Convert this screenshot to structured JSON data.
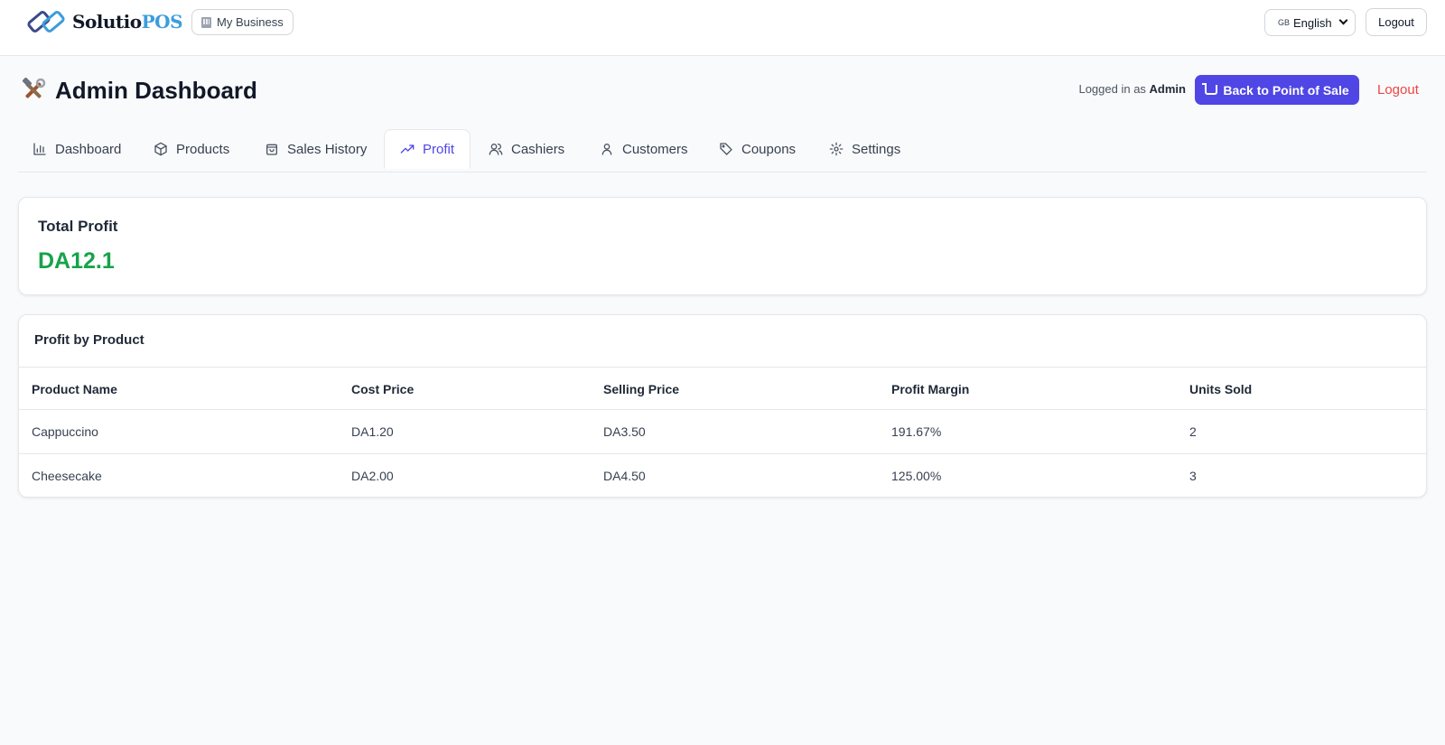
{
  "topbar": {
    "logo_part1": "Solutio",
    "logo_part2": "POS",
    "business_label": "My Business",
    "language": {
      "flag": "GB",
      "selected": "English"
    },
    "logout_label": "Logout"
  },
  "header": {
    "title": "Admin Dashboard",
    "logged_prefix": "Logged in as",
    "logged_user": "Admin",
    "back_pos_label": "Back to Point of Sale",
    "logout_label": "Logout"
  },
  "tabs": [
    {
      "label": "Dashboard",
      "icon": "bar-chart-icon"
    },
    {
      "label": "Products",
      "icon": "package-icon"
    },
    {
      "label": "Sales History",
      "icon": "shopping-bag-icon"
    },
    {
      "label": "Profit",
      "icon": "trending-up-icon",
      "active": true
    },
    {
      "label": "Cashiers",
      "icon": "users-icon"
    },
    {
      "label": "Customers",
      "icon": "user-icon"
    },
    {
      "label": "Coupons",
      "icon": "tag-icon"
    },
    {
      "label": "Settings",
      "icon": "gear-icon"
    }
  ],
  "total_profit": {
    "label": "Total Profit",
    "value": "DA12.1"
  },
  "profit_table": {
    "title": "Profit by Product",
    "columns": [
      "Product Name",
      "Cost Price",
      "Selling Price",
      "Profit Margin",
      "Units Sold"
    ],
    "rows": [
      [
        "Cappuccino",
        "DA1.20",
        "DA3.50",
        "191.67%",
        "2"
      ],
      [
        "Cheesecake",
        "DA2.00",
        "DA4.50",
        "125.00%",
        "3"
      ]
    ]
  },
  "colors": {
    "accent": "#4f46e5",
    "profit": "#16a34a",
    "logout": "#ef4444",
    "logo_blue": "#3b9ddd"
  }
}
